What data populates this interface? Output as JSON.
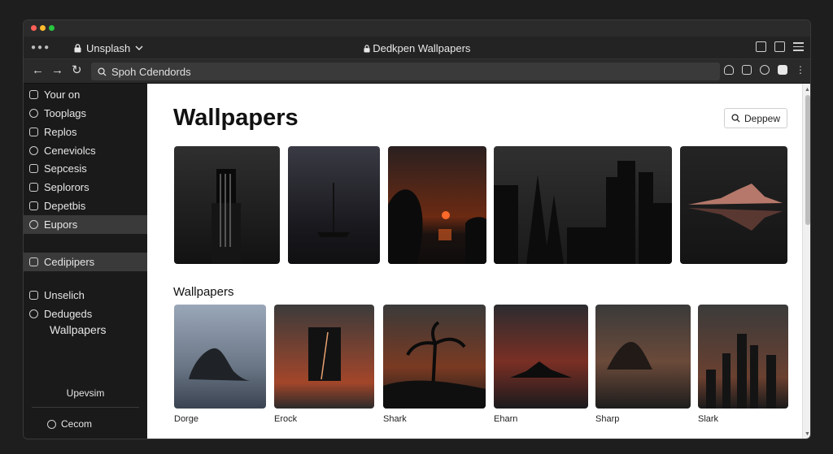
{
  "tab": {
    "site_label": "Unsplash",
    "title": "Dedkpen Wallpapers"
  },
  "toolbar": {
    "url": "Spoh Cdendords"
  },
  "sidebar": {
    "items": [
      {
        "label": "Your on",
        "icon": "shield-icon"
      },
      {
        "label": "Tooplags",
        "icon": "info-icon"
      },
      {
        "label": "Replos",
        "icon": "grid-icon"
      },
      {
        "label": "Ceneviolcs",
        "icon": "camera-icon"
      },
      {
        "label": "Sepcesis",
        "icon": "link-icon"
      },
      {
        "label": "Seplorors",
        "icon": "folder-icon"
      },
      {
        "label": "Depetbis",
        "icon": "book-icon"
      },
      {
        "label": "Eupors",
        "icon": "smiley-icon"
      },
      {
        "label": "Cedipipers",
        "icon": "image-icon"
      },
      {
        "label": "Unselich",
        "icon": "monitor-icon"
      },
      {
        "label": "Dedugeds",
        "icon": "pin-icon"
      }
    ],
    "sub_label": "Wallpapers",
    "upgrade_label": "Upevsim",
    "footer_label": "Cecom"
  },
  "main": {
    "title": "Wallpapers",
    "search_label": "Deppew",
    "section_title": "Wallpapers",
    "gallery_bottom": [
      {
        "caption": "Dorge"
      },
      {
        "caption": "Erock"
      },
      {
        "caption": "Shark"
      },
      {
        "caption": "Eharn"
      },
      {
        "caption": "Sharp"
      },
      {
        "caption": "Slark"
      }
    ]
  },
  "colors": {
    "window_bg": "#1b1b1b",
    "sidebar_active": "#3a3a3a",
    "content_bg": "#ffffff"
  }
}
